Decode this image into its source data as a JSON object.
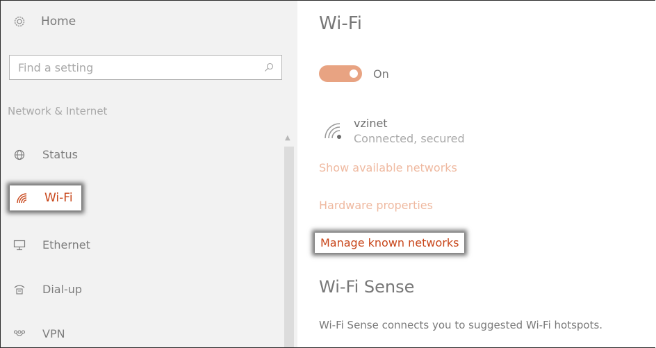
{
  "sidebar": {
    "home_label": "Home",
    "search_placeholder": "Find a setting",
    "section_heading": "Network & Internet",
    "items": [
      {
        "label": "Status",
        "icon": "globe-icon"
      },
      {
        "label": "Wi-Fi",
        "icon": "wifi-icon",
        "selected": true
      },
      {
        "label": "Ethernet",
        "icon": "ethernet-icon"
      },
      {
        "label": "Dial-up",
        "icon": "dialup-icon"
      },
      {
        "label": "VPN",
        "icon": "vpn-icon"
      }
    ]
  },
  "main": {
    "title": "Wi-Fi",
    "toggle": {
      "state_label": "On",
      "on": true
    },
    "network": {
      "name": "vzinet",
      "status": "Connected, secured"
    },
    "links": {
      "available": "Show available networks",
      "hardware": "Hardware properties",
      "manage": "Manage known networks"
    },
    "sense_title": "Wi-Fi Sense",
    "sense_description": "Wi-Fi Sense connects you to suggested Wi-Fi hotspots."
  },
  "colors": {
    "accent": "#c8461a",
    "toggle_on": "#e8a382",
    "link_faded": "#efb9a0",
    "sidebar_bg": "#f2f2f2"
  }
}
